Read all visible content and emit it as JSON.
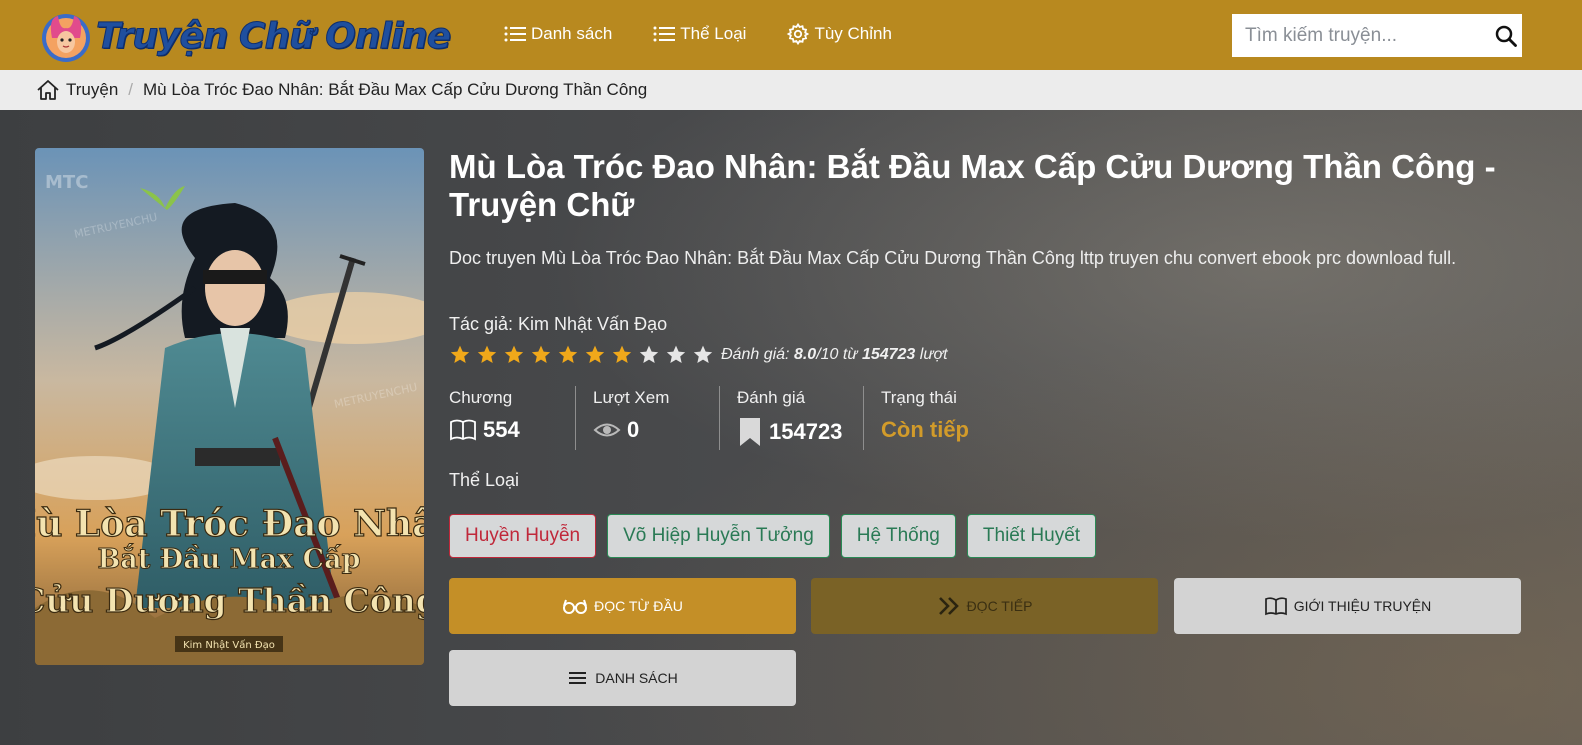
{
  "header": {
    "logo_text": "Truyện Chữ Online",
    "nav": [
      {
        "label": "Danh sách",
        "icon": "list-icon"
      },
      {
        "label": "Thể Loại",
        "icon": "list-icon"
      },
      {
        "label": "Tùy Chỉnh",
        "icon": "gear-icon"
      }
    ],
    "search_placeholder": "Tìm kiếm truyện...",
    "search_icon": "search-icon"
  },
  "breadcrumb": {
    "home_label": "Truyện",
    "current": "Mù Lòa Tróc Đao Nhân: Bắt Đầu Max Cấp Cửu Dương Thần Công"
  },
  "cover": {
    "brand": "MTC",
    "watermark": "METRUYENCHU",
    "title_lines": [
      "Mù Lòa Tróc Đao Nhân",
      "Bắt Đầu Max Cấp",
      "Cửu Dương Thần Công"
    ],
    "author_tag": "Kim Nhật Vấn Đạo"
  },
  "story": {
    "title": "Mù Lòa Tróc Đao Nhân: Bắt Đầu Max Cấp Cửu Dương Thần Công - Truyện Chữ",
    "description": "Doc truyen Mù Lòa Tróc Đao Nhân: Bắt Đầu Max Cấp Cửu Dương Thần Công lttp truyen chu convert ebook prc download full.",
    "author_label": "Tác giả: Kim Nhật Vấn Đạo",
    "rating": {
      "stars_total": 10,
      "stars_filled": 7,
      "prefix": "Đánh giá:",
      "score": "8.0",
      "out_of": "/10 từ",
      "count": "154723",
      "suffix": "lượt"
    },
    "stats": [
      {
        "label": "Chương",
        "value": "554",
        "icon": "book-icon"
      },
      {
        "label": "Lượt Xem",
        "value": "0",
        "icon": "eye-icon"
      },
      {
        "label": "Đánh giá",
        "value": "154723",
        "icon": "bookmark-icon"
      },
      {
        "label": "Trạng thái",
        "value": "Còn tiếp"
      }
    ],
    "genre_label": "Thể Loại",
    "genres": [
      "Huyền Huyễn",
      "Võ Hiệp Huyễn Tưởng",
      "Hệ Thống",
      "Thiết Huyết"
    ]
  },
  "actions": {
    "read_first": "ĐỌC TỪ ĐẦU",
    "read_next": "ĐỌC TIẾP",
    "intro": "GIỚI THIỆU TRUYỆN",
    "list": "DANH SÁCH"
  },
  "colors": {
    "header_bg": "#b8891f",
    "status_orange": "#d29b2a",
    "star_gold": "#f0a81a",
    "genre_red": "#c0283a",
    "genre_green": "#2a7a55"
  }
}
